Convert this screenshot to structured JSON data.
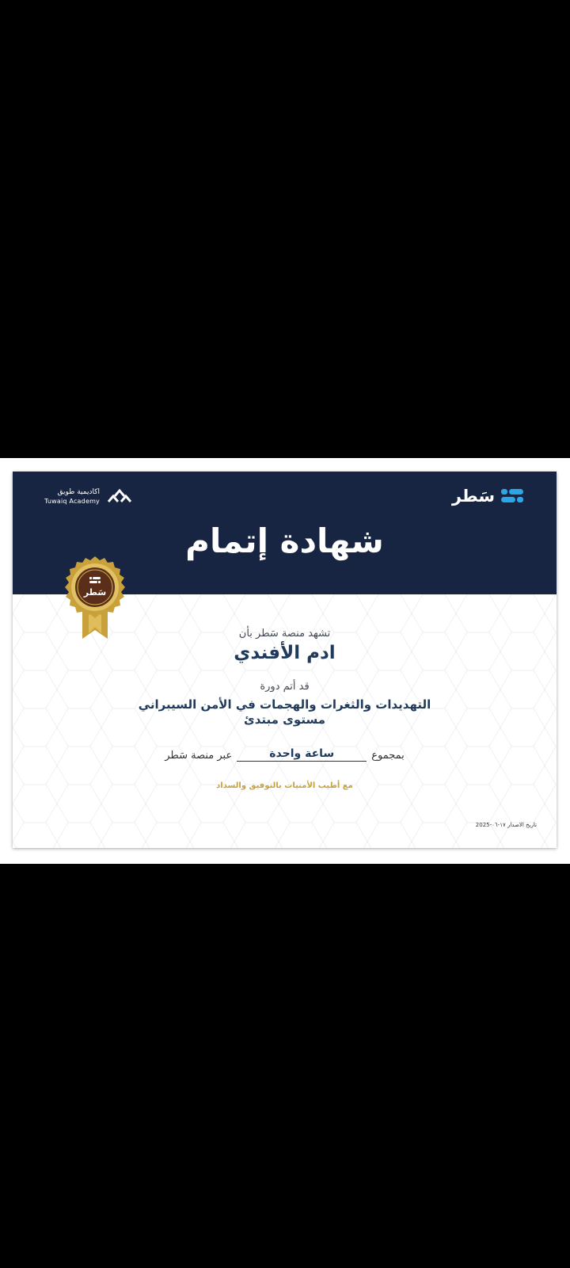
{
  "certificate": {
    "brand_name": "سَطر",
    "partner_name_ar": "اكاديمية طويق",
    "partner_name_en": "Tuwaiq Academy",
    "title": "شهادة إتمام",
    "seal_label": "سَطر",
    "intro": "تشهد منصة سَطر بأن",
    "recipient": "ادم الأفندي",
    "completed_label": "قد أتم دورة",
    "course_title": "التهديدات والثغرات والهجمات في الأمن السيبراني",
    "course_level": "مستوى مبتدئ",
    "duration_prefix": "بمجموع",
    "duration_value": "ساعة واحدة",
    "duration_suffix": "عبر منصة سَطر",
    "wishes": "مع أطيب الأمنيات بالتوفيق والسداد",
    "issue_date": "تاريخ الاصدار ١٧-٠٦-2025"
  },
  "colors": {
    "header_bg": "#172442",
    "accent_blue": "#2aa7e6",
    "gold": "#c9a13a",
    "navy_text": "#1f3a5a"
  },
  "icons": {
    "brand_logo": "satr-logo-icon",
    "partner_logo": "tuwaiq-logo-icon",
    "seal": "gold-seal-icon"
  }
}
